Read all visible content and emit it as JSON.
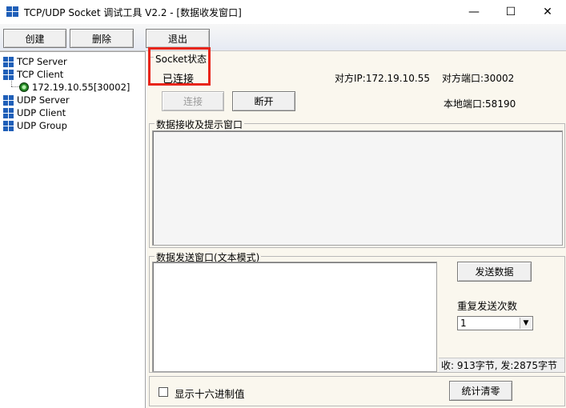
{
  "window": {
    "title": "TCP/UDP Socket 调试工具 V2.2 - [数据收发窗口]",
    "minimize": "—",
    "maximize": "☐",
    "close": "✕"
  },
  "toolbar": {
    "create_label": "创建",
    "delete_label": "删除",
    "exit_label": "退出"
  },
  "tree": {
    "items": [
      {
        "label": "TCP Server",
        "icon": "network-node-icon"
      },
      {
        "label": "TCP Client",
        "icon": "network-node-icon"
      },
      {
        "label": "172.19.10.55[30002]",
        "icon": "connected-icon"
      },
      {
        "label": "UDP Server",
        "icon": "network-node-icon"
      },
      {
        "label": "UDP Client",
        "icon": "network-node-icon"
      },
      {
        "label": "UDP Group",
        "icon": "network-node-icon"
      }
    ]
  },
  "socket": {
    "group_label": "Socket状态",
    "status": "已连接",
    "remote_ip_label": "对方IP:172.19.10.55",
    "remote_port_label": "对方端口:30002",
    "local_port_label": "本地端口:58190",
    "connect_label": "连接",
    "disconnect_label": "断开"
  },
  "receive": {
    "group_label": "数据接收及提示窗口"
  },
  "send": {
    "group_label": "数据发送窗口(文本模式)",
    "send_button_label": "发送数据",
    "repeat_label": "重复发送次数",
    "repeat_value": "1",
    "stats_text": "收: 913字节, 发:2875字节"
  },
  "bottom": {
    "hex_label": "显示十六进制值",
    "clear_stats_label": "统计清零"
  },
  "colors": {
    "highlight_border": "#e8251b",
    "panel_background": "#faf7ee",
    "icon_blue": "#1f5fb8"
  }
}
